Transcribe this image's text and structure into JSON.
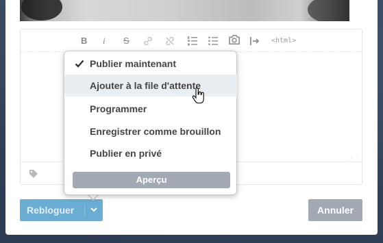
{
  "editor": {
    "toolbar": {
      "bold": "B",
      "italic": "i",
      "strike": "S",
      "html": "<html>"
    }
  },
  "publish_menu": {
    "items": [
      {
        "label": "Publier maintenant",
        "checked": true
      },
      {
        "label": "Ajouter à la file d'attente",
        "hovered": true
      },
      {
        "label": "Programmer"
      },
      {
        "label": "Enregistrer comme brouillon"
      },
      {
        "label": "Publier en privé"
      }
    ],
    "preview_label": "Aperçu"
  },
  "actions": {
    "reblog_label": "Rebloguer",
    "cancel_label": "Annuler"
  },
  "colors": {
    "accent_blue": "#529ecc",
    "gray_button": "#a3a9b2",
    "hover_row": "#e9eef3",
    "background": "#36465d"
  },
  "icons": [
    "bold-icon",
    "italic-icon",
    "strikethrough-icon",
    "link-icon",
    "unlink-icon",
    "numbered-list-icon",
    "bullet-list-icon",
    "camera-icon",
    "read-more-icon",
    "tag-icon",
    "checkmark-icon",
    "chevron-down-icon",
    "hand-cursor-icon"
  ]
}
